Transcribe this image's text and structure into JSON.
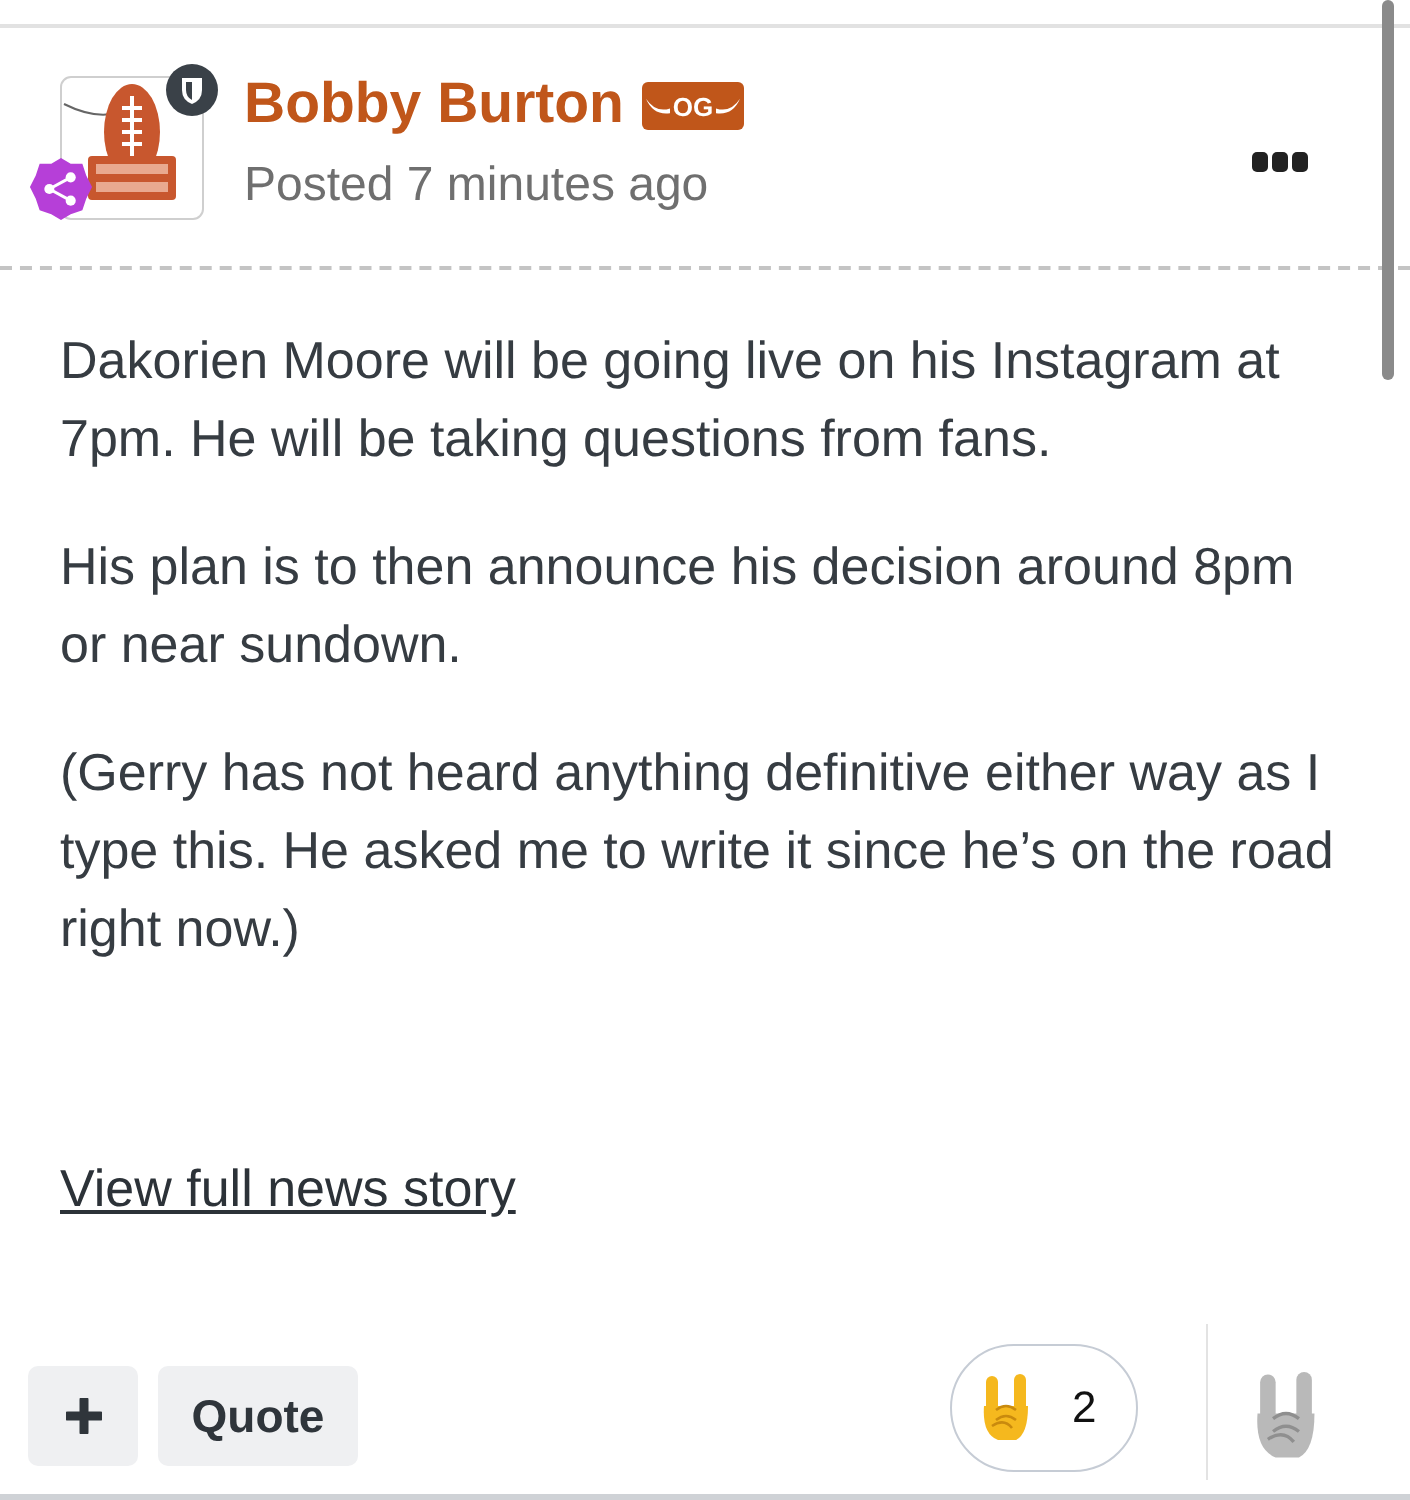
{
  "post": {
    "author": {
      "name": "Bobby Burton",
      "badge": "OG"
    },
    "posted": "Posted 7 minutes ago",
    "body": [
      "Dakorien Moore will be going live on his Instagram at 7pm. He will be taking questions from fans.",
      "His plan is to then announce his decision around 8pm or near sundown.",
      "(Gerry has not heard anything definitive either way as I type this. He asked me to write it since he’s on the road right now.)"
    ],
    "link": "View full news story"
  },
  "actions": {
    "quote": "Quote"
  },
  "reactions": [
    {
      "count": "2"
    }
  ]
}
